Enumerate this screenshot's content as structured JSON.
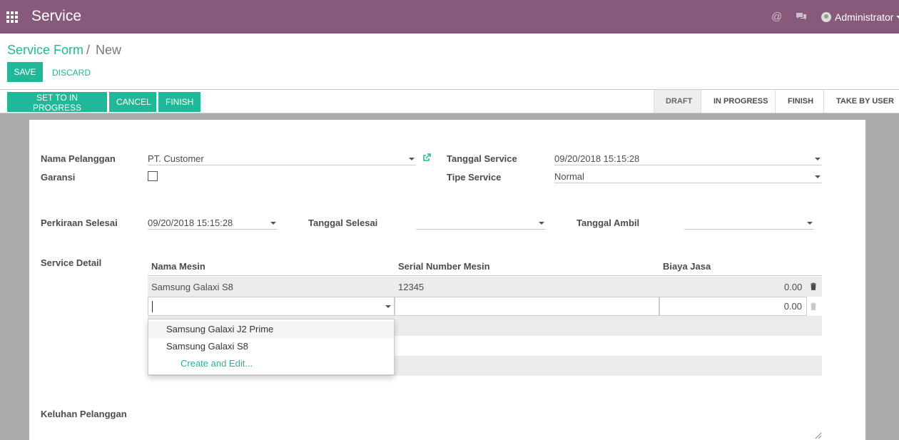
{
  "topbar": {
    "app_title": "Service",
    "user_name": "Administrator",
    "accent": "#875a7b",
    "icons": [
      "apps-icon",
      "mention-icon",
      "chat-icon",
      "avatar"
    ]
  },
  "breadcrumb": {
    "parent": "Service Form",
    "separator": "/",
    "current": "New"
  },
  "buttons": {
    "save": "Save",
    "discard": "Discard",
    "set_in_progress": "Set To In Progress",
    "cancel": "Cancel",
    "finish": "Finish"
  },
  "stages": [
    "Draft",
    "In Progress",
    "Finish",
    "Take By User"
  ],
  "active_stage": "Draft",
  "form": {
    "nama_pelanggan_label": "Nama Pelanggan",
    "nama_pelanggan_value": "PT. Customer",
    "garansi_label": "Garansi",
    "tanggal_service_label": "Tanggal Service",
    "tanggal_service_value": "09/20/2018 15:15:28",
    "tipe_service_label": "Tipe Service",
    "tipe_service_value": "Normal",
    "perkiraan_selesai_label": "Perkiraan Selesai",
    "perkiraan_selesai_value": "09/20/2018 15:15:28",
    "tanggal_selesai_label": "Tanggal Selesai",
    "tanggal_selesai_value": "",
    "tanggal_ambil_label": "Tanggal Ambil",
    "tanggal_ambil_value": "",
    "service_detail_label": "Service Detail",
    "keluhan_label": "Keluhan Pelanggan"
  },
  "table": {
    "headers": [
      "Nama Mesin",
      "Serial Number Mesin",
      "Biaya Jasa"
    ],
    "rows": [
      {
        "nama_mesin": "Samsung Galaxi S8",
        "serial": "12345",
        "biaya": "0.00"
      }
    ],
    "editing_row": {
      "nama_mesin": "",
      "serial": "",
      "biaya": "0.00"
    }
  },
  "dropdown": {
    "options": [
      "Samsung Galaxi J2 Prime",
      "Samsung Galaxi S8"
    ],
    "create_label": "Create and Edit..."
  }
}
